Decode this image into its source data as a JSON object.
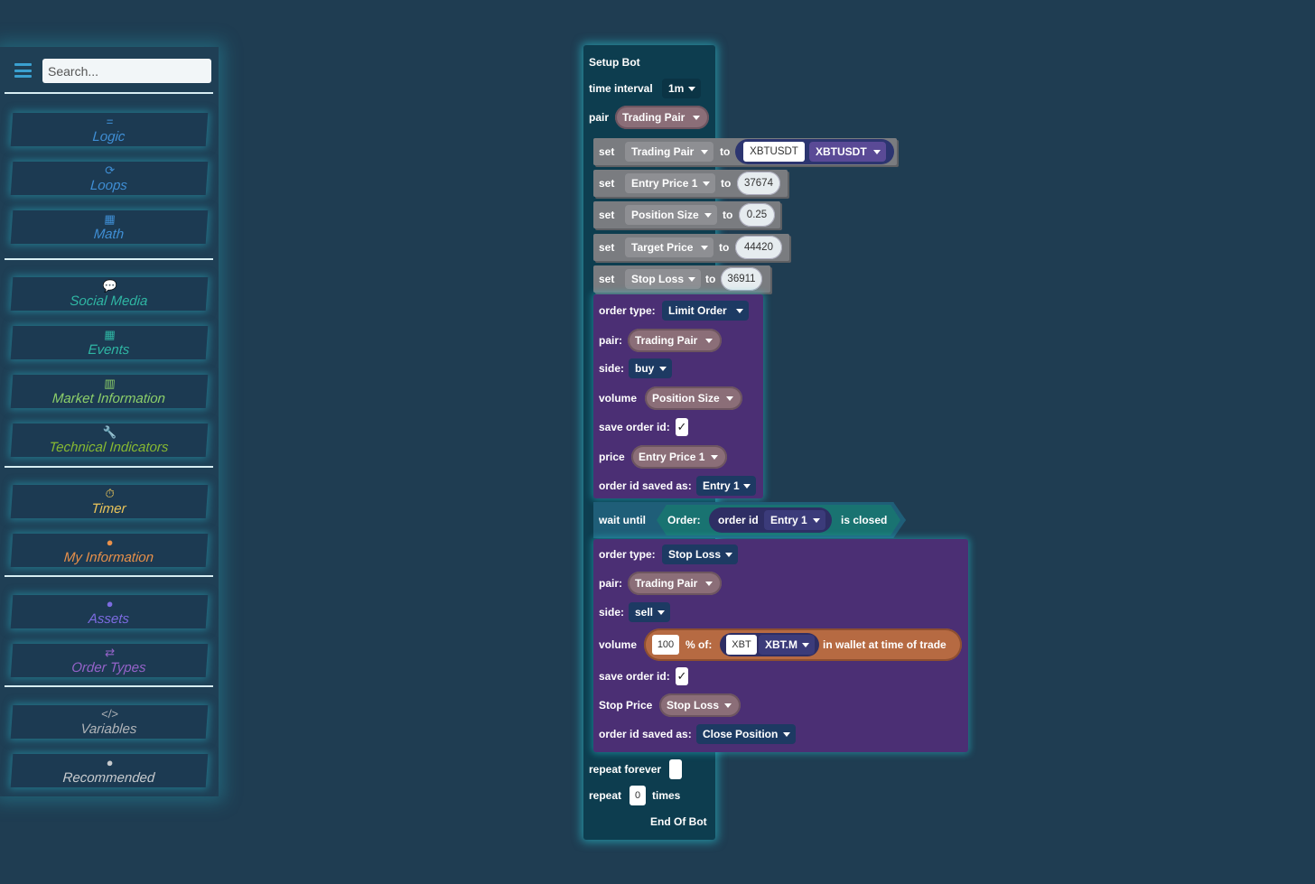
{
  "sidebar": {
    "search_placeholder": "Search...",
    "categories": [
      {
        "label": "Logic",
        "icon": "equals-icon",
        "glyph": "=",
        "color": "#3f8ed4"
      },
      {
        "label": "Loops",
        "icon": "refresh-icon",
        "glyph": "⟳",
        "color": "#3f8ed4"
      },
      {
        "label": "Math",
        "icon": "calculator-icon",
        "glyph": "▦",
        "color": "#3f8ed4"
      },
      {
        "label": "Social Media",
        "icon": "comments-icon",
        "glyph": "💬",
        "color": "#2fb5a3"
      },
      {
        "label": "Events",
        "icon": "calendar-icon",
        "glyph": "▦",
        "color": "#2fb5a3"
      },
      {
        "label": "Market Information",
        "icon": "bar-chart-icon",
        "glyph": "▥",
        "color": "#8ccf6a"
      },
      {
        "label": "Technical Indicators",
        "icon": "wrench-icon",
        "glyph": "🔧",
        "color": "#86b832"
      },
      {
        "label": "Timer",
        "icon": "stopwatch-icon",
        "glyph": "⏱",
        "color": "#e8c35a"
      },
      {
        "label": "My Information",
        "icon": "user-icon",
        "glyph": "●",
        "color": "#e8904a"
      },
      {
        "label": "Assets",
        "icon": "coin-icon",
        "glyph": "●",
        "color": "#7c6be0"
      },
      {
        "label": "Order Types",
        "icon": "exchange-icon",
        "glyph": "⇄",
        "color": "#9563c9"
      },
      {
        "label": "Variables",
        "icon": "code-icon",
        "glyph": "</>",
        "color": "#b0b4b8"
      },
      {
        "label": "Recommended",
        "icon": "lightbulb-icon",
        "glyph": "●",
        "color": "#c6c9cc"
      }
    ]
  },
  "setup": {
    "title": "Setup Bot",
    "time_interval_label": "time interval",
    "time_interval_value": "1m",
    "pair_label": "pair",
    "pair_value": "Trading Pair"
  },
  "sets": [
    {
      "kw": "set",
      "var": "Trading Pair",
      "to": "to",
      "value": "XBTUSDT",
      "value2": "XBTUSDT"
    },
    {
      "kw": "set",
      "var": "Entry Price 1",
      "to": "to",
      "value": "37674"
    },
    {
      "kw": "set",
      "var": "Position Size",
      "to": "to",
      "value": "0.25"
    },
    {
      "kw": "set",
      "var": "Target Price",
      "to": "to",
      "value": "44420"
    },
    {
      "kw": "set",
      "var": "Stop Loss",
      "to": "to",
      "value": "36911"
    }
  ],
  "order1": {
    "type_label": "order type:",
    "type_value": "Limit Order",
    "pair_label": "pair:",
    "pair_value": "Trading Pair",
    "side_label": "side:",
    "side_value": "buy",
    "volume_label": "volume",
    "volume_value": "Position Size",
    "save_label": "save order id:",
    "save_checked": "✓",
    "price_label": "price",
    "price_value": "Entry Price 1",
    "saved_as_label": "order id saved as:",
    "saved_as_value": "Entry 1"
  },
  "wait": {
    "label": "wait until",
    "order_label": "Order:",
    "order_id_label": "order id",
    "order_id_value": "Entry 1",
    "state": "is closed"
  },
  "order2": {
    "type_label": "order type:",
    "type_value": "Stop Loss",
    "pair_label": "pair:",
    "pair_value": "Trading Pair",
    "side_label": "side:",
    "side_value": "sell",
    "volume_label": "volume",
    "volume_pct": "100",
    "pct_of": "% of:",
    "asset_input": "XBT",
    "asset_value": "XBT.M",
    "wallet_text": "in wallet at time of trade",
    "save_label": "save order id:",
    "save_checked": "✓",
    "stop_label": "Stop Price",
    "stop_value": "Stop Loss",
    "saved_as_label": "order id saved as:",
    "saved_as_value": "Close Position"
  },
  "footer": {
    "repeat_forever": "repeat forever",
    "repeat_label": "repeat",
    "repeat_count": "0",
    "times": "times",
    "end": "End Of Bot"
  }
}
